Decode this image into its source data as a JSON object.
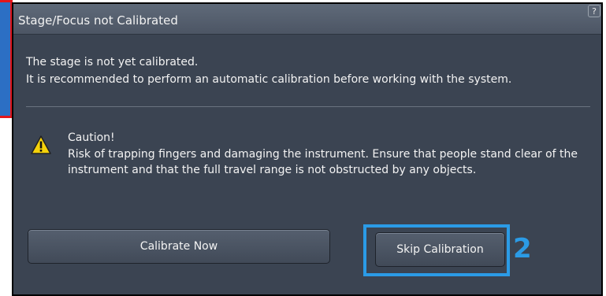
{
  "dialog": {
    "title": "Stage/Focus not Calibrated",
    "help_label": "?",
    "message_line1": "The stage is not yet calibrated.",
    "message_line2": "It is recommended to perform an automatic calibration before working with the system."
  },
  "caution": {
    "title": "Caution!",
    "text": "Risk of trapping fingers and damaging the instrument. Ensure that people stand clear of the instrument and that the full travel range is not obstructed by any objects.",
    "icon": "warning-triangle-icon"
  },
  "buttons": {
    "calibrate_now": "Calibrate Now",
    "skip_calibration": "Skip Calibration"
  },
  "annotation": {
    "callout_number": "2",
    "highlight_color": "#2b9be6",
    "left_marker_color": "#e3161b"
  },
  "colors": {
    "dialog_background": "#3b4452",
    "titlebar": "#55606f",
    "warning_yellow": "#f5d20a"
  }
}
